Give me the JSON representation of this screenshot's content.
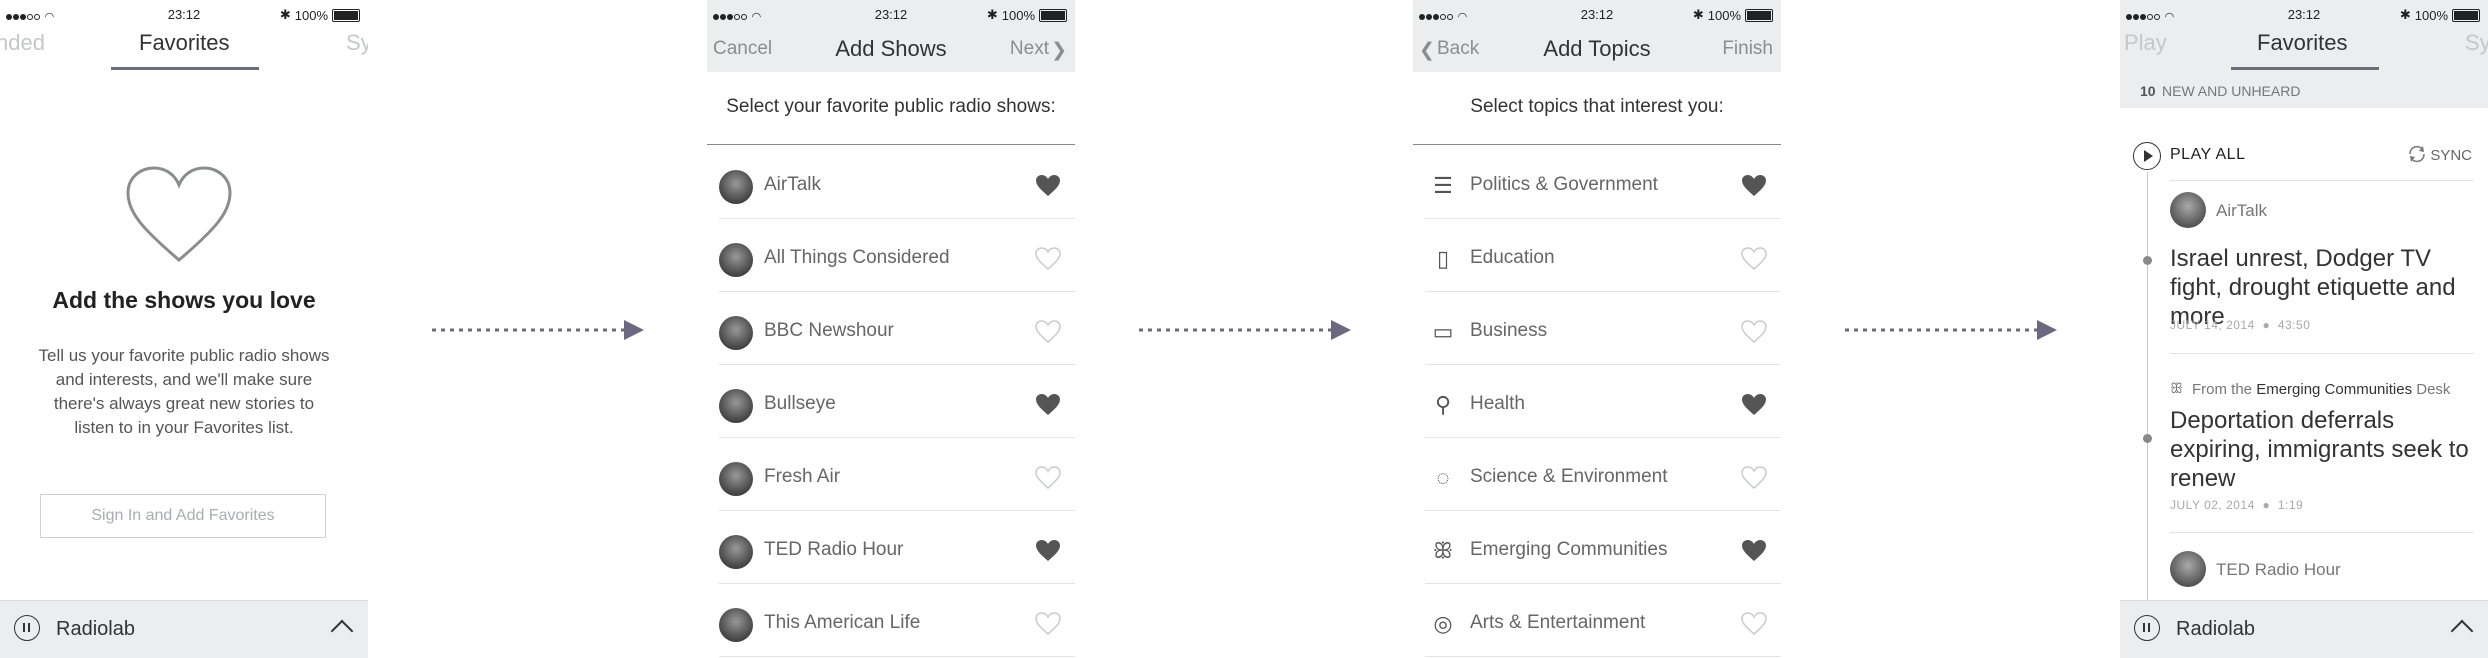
{
  "status": {
    "time": "23:12",
    "battery": "100%"
  },
  "screen1": {
    "tabs": [
      "nded",
      "Favorites",
      "Sy"
    ],
    "title": "Add the shows you love",
    "body": "Tell us your favorite public radio shows and interests, and we'll make sure there's always great new stories to listen to in your Favorites list.",
    "button": "Sign In and Add Favorites"
  },
  "screen2": {
    "nav": {
      "left": "Cancel",
      "title": "Add Shows",
      "right": "Next"
    },
    "prompt": "Select your favorite public radio shows:",
    "shows": [
      {
        "label": "AirTalk",
        "favorited": true
      },
      {
        "label": "All Things Considered",
        "favorited": false
      },
      {
        "label": "BBC Newshour",
        "favorited": false
      },
      {
        "label": "Bullseye",
        "favorited": true
      },
      {
        "label": "Fresh Air",
        "favorited": false
      },
      {
        "label": "TED Radio Hour",
        "favorited": true
      },
      {
        "label": "This American Life",
        "favorited": false
      }
    ]
  },
  "screen3": {
    "nav": {
      "left": "Back",
      "title": "Add Topics",
      "right": "Finish"
    },
    "prompt": "Select topics that interest you:",
    "topics": [
      {
        "label": "Politics & Government",
        "icon": "flag-icon",
        "favorited": true
      },
      {
        "label": "Education",
        "icon": "ruler-icon",
        "favorited": false
      },
      {
        "label": "Business",
        "icon": "briefcase-icon",
        "favorited": false
      },
      {
        "label": "Health",
        "icon": "syringe-icon",
        "favorited": true
      },
      {
        "label": "Science & Environment",
        "icon": "lightbulb-icon",
        "favorited": false
      },
      {
        "label": "Emerging Communities",
        "icon": "people-icon",
        "favorited": true
      },
      {
        "label": "Arts & Entertainment",
        "icon": "palette-icon",
        "favorited": false
      }
    ]
  },
  "screen4": {
    "tabs": [
      "Play",
      "Favorites",
      "Sy"
    ],
    "new_count": "10",
    "new_label": "NEW AND UNHEARD",
    "play_all": "PLAY ALL",
    "sync": "SYNC",
    "item1": {
      "show": "AirTalk",
      "headline": "Israel unrest, Dodger TV fight, drought etiquette and more",
      "date": "JULY 14, 2014",
      "duration": "43:50"
    },
    "item2": {
      "desk_prefix": "From the",
      "desk_name": "Emerging Communities",
      "desk_suffix": "Desk",
      "headline": "Deportation deferrals expiring, immigrants seek to renew",
      "date": "JULY 02, 2014",
      "duration": "1:19"
    },
    "item3": {
      "show": "TED Radio Hour"
    }
  },
  "player": {
    "title": "Radiolab"
  },
  "colors": {
    "arrow": "#6b6880",
    "heart_filled": "#555555",
    "heart_outline": "#c8cacd"
  }
}
